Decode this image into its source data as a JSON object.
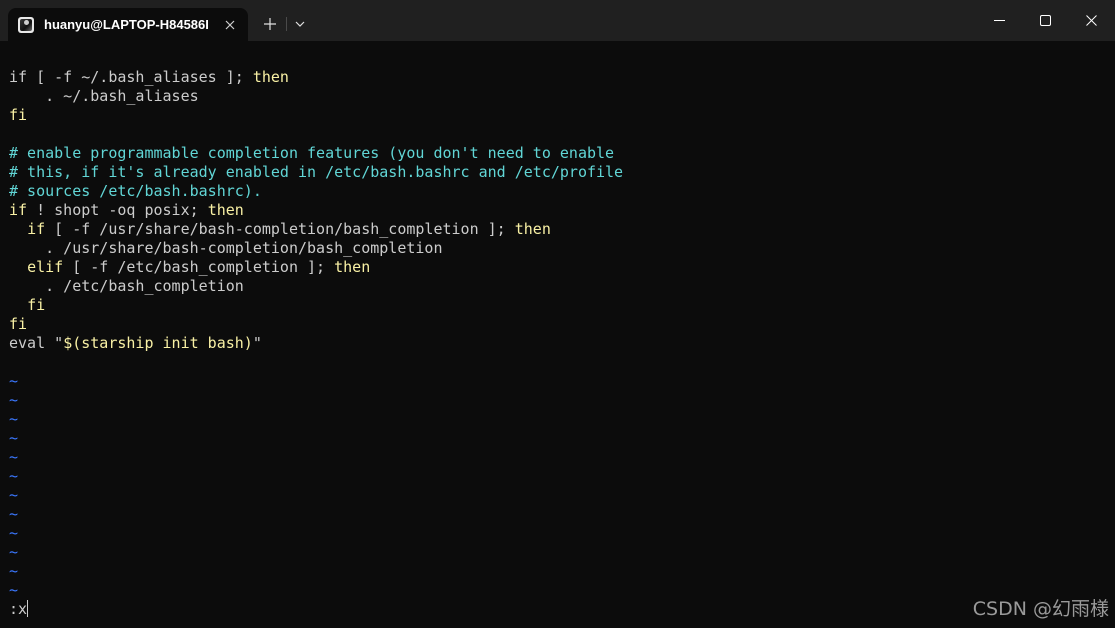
{
  "window": {
    "tab_title": "huanyu@LAPTOP-H84586I",
    "icons": {
      "tab": "terminal-avatar-icon",
      "tab_close": "close-icon",
      "new_tab": "plus-icon",
      "dropdown": "chevron-down-icon",
      "minimize": "minimize-icon",
      "maximize": "maximize-icon",
      "close": "close-icon"
    }
  },
  "colors": {
    "background": "#0c0c0c",
    "titlebar": "#202020",
    "text": "#cccccc",
    "keyword": "#f9f1a5",
    "comment": "#61d6d6",
    "tilde": "#3b78ff"
  },
  "editor": {
    "lines": [
      [
        {
          "t": "if [ -f ~/.bash_aliases ]; ",
          "c": ""
        },
        {
          "t": "then",
          "c": "kw"
        }
      ],
      [
        {
          "t": "    . ~/.bash_aliases",
          "c": ""
        }
      ],
      [
        {
          "t": "fi",
          "c": "kw"
        }
      ],
      [
        {
          "t": "",
          "c": ""
        }
      ],
      [
        {
          "t": "# enable programmable completion features (you don't need to enable",
          "c": "cm"
        }
      ],
      [
        {
          "t": "# this, if it's already enabled in /etc/bash.bashrc and /etc/profile",
          "c": "cm"
        }
      ],
      [
        {
          "t": "# sources /etc/bash.bashrc).",
          "c": "cm"
        }
      ],
      [
        {
          "t": "if",
          "c": "kw"
        },
        {
          "t": " ! shopt -oq posix; ",
          "c": ""
        },
        {
          "t": "then",
          "c": "kw"
        }
      ],
      [
        {
          "t": "  ",
          "c": ""
        },
        {
          "t": "if",
          "c": "kw"
        },
        {
          "t": " [ -f /usr/share/bash-completion/bash_completion ]; ",
          "c": ""
        },
        {
          "t": "then",
          "c": "kw"
        }
      ],
      [
        {
          "t": "    . /usr/share/bash-completion/bash_completion",
          "c": ""
        }
      ],
      [
        {
          "t": "  ",
          "c": ""
        },
        {
          "t": "elif",
          "c": "kw"
        },
        {
          "t": " [ -f /etc/bash_completion ]; ",
          "c": ""
        },
        {
          "t": "then",
          "c": "kw"
        }
      ],
      [
        {
          "t": "    . /etc/bash_completion",
          "c": ""
        }
      ],
      [
        {
          "t": "  ",
          "c": ""
        },
        {
          "t": "fi",
          "c": "kw"
        }
      ],
      [
        {
          "t": "fi",
          "c": "kw"
        }
      ],
      [
        {
          "t": "eval \"",
          "c": ""
        },
        {
          "t": "$(starship init bash)",
          "c": "kw"
        },
        {
          "t": "\"",
          "c": ""
        }
      ],
      [
        {
          "t": "",
          "c": ""
        }
      ],
      [
        {
          "t": "~",
          "c": "tl"
        }
      ],
      [
        {
          "t": "~",
          "c": "tl"
        }
      ],
      [
        {
          "t": "~",
          "c": "tl"
        }
      ],
      [
        {
          "t": "~",
          "c": "tl"
        }
      ],
      [
        {
          "t": "~",
          "c": "tl"
        }
      ],
      [
        {
          "t": "~",
          "c": "tl"
        }
      ],
      [
        {
          "t": "~",
          "c": "tl"
        }
      ],
      [
        {
          "t": "~",
          "c": "tl"
        }
      ],
      [
        {
          "t": "~",
          "c": "tl"
        }
      ],
      [
        {
          "t": "~",
          "c": "tl"
        }
      ],
      [
        {
          "t": "~",
          "c": "tl"
        }
      ],
      [
        {
          "t": "~",
          "c": "tl"
        }
      ]
    ],
    "command_line": ":x"
  },
  "watermark": "CSDN @幻雨様"
}
